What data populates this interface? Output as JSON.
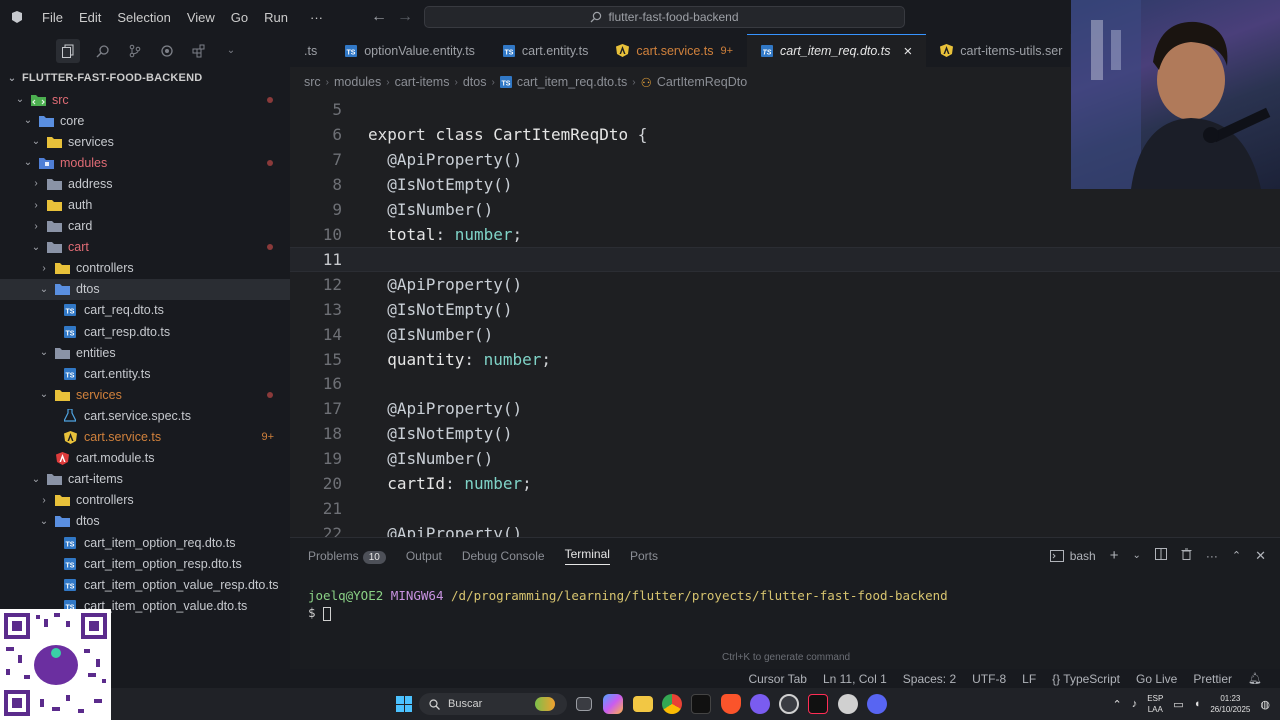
{
  "titlebar": {
    "menus": [
      "File",
      "Edit",
      "Selection",
      "View",
      "Go",
      "Run"
    ],
    "more": "···",
    "search": "flutter-fast-food-backend"
  },
  "sidebar": {
    "title": "FLUTTER-FAST-FOOD-BACKEND",
    "items": [
      {
        "label": "src",
        "indent": 1,
        "type": "folder-src",
        "open": true,
        "dot": true,
        "color": "#e06c75"
      },
      {
        "label": "core",
        "indent": 2,
        "type": "folder-blue",
        "open": true
      },
      {
        "label": "services",
        "indent": 3,
        "type": "folder-yellow",
        "open": true
      },
      {
        "label": "modules",
        "indent": 2,
        "type": "folder-mod",
        "open": true,
        "dot": true,
        "color": "#e06c75"
      },
      {
        "label": "address",
        "indent": 3,
        "type": "folder",
        "open": false
      },
      {
        "label": "auth",
        "indent": 3,
        "type": "folder-yellow",
        "open": false
      },
      {
        "label": "card",
        "indent": 3,
        "type": "folder",
        "open": false
      },
      {
        "label": "cart",
        "indent": 3,
        "type": "folder",
        "open": true,
        "dot": true,
        "color": "#e06c75"
      },
      {
        "label": "controllers",
        "indent": 4,
        "type": "folder-yellow",
        "open": false
      },
      {
        "label": "dtos",
        "indent": 4,
        "type": "folder-blue",
        "open": true,
        "selected": true
      },
      {
        "label": "cart_req.dto.ts",
        "indent": 5,
        "type": "ts"
      },
      {
        "label": "cart_resp.dto.ts",
        "indent": 5,
        "type": "ts"
      },
      {
        "label": "entities",
        "indent": 4,
        "type": "folder",
        "open": true
      },
      {
        "label": "cart.entity.ts",
        "indent": 5,
        "type": "ts"
      },
      {
        "label": "services",
        "indent": 4,
        "type": "folder-yellow",
        "open": true,
        "dot": true,
        "color": "#d0813c"
      },
      {
        "label": "cart.service.spec.ts",
        "indent": 5,
        "type": "spec"
      },
      {
        "label": "cart.service.ts",
        "indent": 5,
        "type": "angular",
        "badge": "9+",
        "color": "#d0813c"
      },
      {
        "label": "cart.module.ts",
        "indent": 4,
        "type": "angular-red"
      },
      {
        "label": "cart-items",
        "indent": 3,
        "type": "folder",
        "open": true
      },
      {
        "label": "controllers",
        "indent": 4,
        "type": "folder-yellow",
        "open": false
      },
      {
        "label": "dtos",
        "indent": 4,
        "type": "folder-blue",
        "open": true
      },
      {
        "label": "cart_item_option_req.dto.ts",
        "indent": 5,
        "type": "ts"
      },
      {
        "label": "cart_item_option_resp.dto.ts",
        "indent": 5,
        "type": "ts"
      },
      {
        "label": "cart_item_option_value_resp.dto.ts",
        "indent": 5,
        "type": "ts"
      },
      {
        "label": "cart_item_option_value.dto.ts",
        "indent": 5,
        "type": "ts"
      }
    ]
  },
  "tabs": [
    {
      "label": ".ts",
      "icon": "none"
    },
    {
      "label": "optionValue.entity.ts",
      "icon": "ts"
    },
    {
      "label": "cart.entity.ts",
      "icon": "ts"
    },
    {
      "label": "cart.service.ts",
      "icon": "angular",
      "badge": "9+",
      "warn": true
    },
    {
      "label": "cart_item_req.dto.ts",
      "icon": "ts",
      "active": true,
      "close": "×"
    },
    {
      "label": "cart-items-utils.ser",
      "icon": "angular"
    }
  ],
  "breadcrumb": [
    "src",
    "modules",
    "cart-items",
    "dtos",
    "cart_item_req.dto.ts",
    "CartItemReqDto"
  ],
  "editor": {
    "current_line": 11,
    "lines": [
      {
        "n": "5",
        "tokens": []
      },
      {
        "n": "6",
        "tokens": [
          [
            "kw2",
            "export "
          ],
          [
            "kw2",
            "class "
          ],
          [
            "cls",
            "CartItemReqDto "
          ],
          [
            "pn",
            "{"
          ]
        ]
      },
      {
        "n": "7",
        "tokens": [
          [
            "dec",
            "  @ApiProperty()"
          ]
        ]
      },
      {
        "n": "8",
        "tokens": [
          [
            "dec",
            "  @IsNotEmpty()"
          ]
        ]
      },
      {
        "n": "9",
        "tokens": [
          [
            "dec",
            "  @IsNumber()"
          ]
        ]
      },
      {
        "n": "10",
        "tokens": [
          [
            "prop",
            "  total"
          ],
          [
            "pn",
            ": "
          ],
          [
            "ty",
            "number"
          ],
          [
            "pn",
            ";"
          ]
        ]
      },
      {
        "n": "11",
        "tokens": []
      },
      {
        "n": "12",
        "tokens": [
          [
            "dec",
            "  @ApiProperty()"
          ]
        ]
      },
      {
        "n": "13",
        "tokens": [
          [
            "dec",
            "  @IsNotEmpty()"
          ]
        ]
      },
      {
        "n": "14",
        "tokens": [
          [
            "dec",
            "  @IsNumber()"
          ]
        ]
      },
      {
        "n": "15",
        "tokens": [
          [
            "prop",
            "  quantity"
          ],
          [
            "pn",
            ": "
          ],
          [
            "ty",
            "number"
          ],
          [
            "pn",
            ";"
          ]
        ]
      },
      {
        "n": "16",
        "tokens": []
      },
      {
        "n": "17",
        "tokens": [
          [
            "dec",
            "  @ApiProperty()"
          ]
        ]
      },
      {
        "n": "18",
        "tokens": [
          [
            "dec",
            "  @IsNotEmpty()"
          ]
        ]
      },
      {
        "n": "19",
        "tokens": [
          [
            "dec",
            "  @IsNumber()"
          ]
        ]
      },
      {
        "n": "20",
        "tokens": [
          [
            "prop",
            "  cartId"
          ],
          [
            "pn",
            ": "
          ],
          [
            "ty",
            "number"
          ],
          [
            "pn",
            ";"
          ]
        ]
      },
      {
        "n": "21",
        "tokens": []
      },
      {
        "n": "22",
        "tokens": [
          [
            "dec",
            "  @ApiProperty()"
          ]
        ]
      }
    ]
  },
  "panel": {
    "tabs": [
      {
        "label": "Problems",
        "badge": "10"
      },
      {
        "label": "Output"
      },
      {
        "label": "Debug Console"
      },
      {
        "label": "Terminal",
        "active": true
      },
      {
        "label": "Ports"
      }
    ],
    "shell": "bash",
    "terminal": {
      "user": "joelq@YOE2",
      "host": "MINGW64",
      "path": "/d/programming/learning/flutter/proyects/flutter-fast-food-backend",
      "prompt": "$"
    },
    "hint": "Ctrl+K to generate command"
  },
  "statusbar": [
    "Cursor Tab",
    "Ln 11, Col 1",
    "Spaces: 2",
    "UTF-8",
    "LF",
    "{} TypeScript",
    "Go Live",
    "Prettier"
  ],
  "taskbar": {
    "search": "Buscar",
    "lang_top": "ESP",
    "lang_bottom": "LAA",
    "time": "01:23",
    "date": "26/10/2025"
  }
}
